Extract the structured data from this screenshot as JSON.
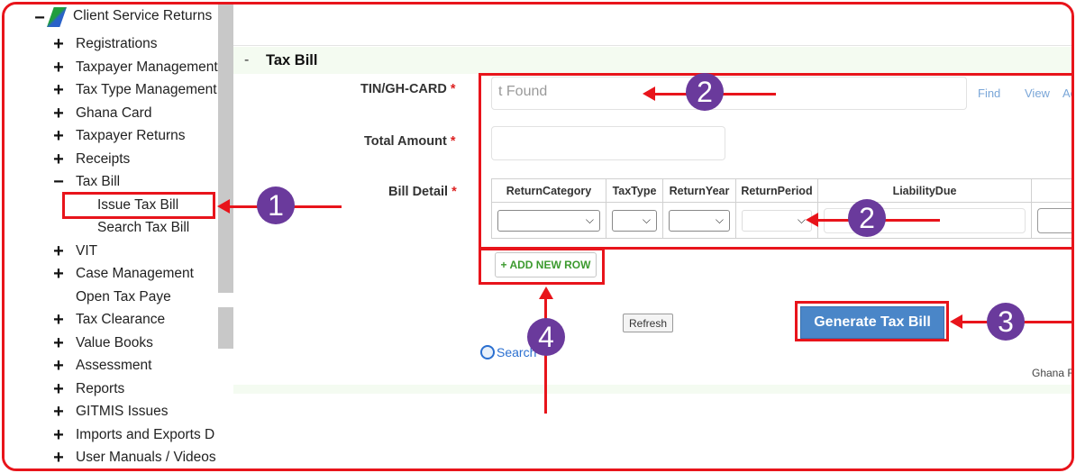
{
  "sidebar": {
    "root_label": "Client Service Returns",
    "items": [
      {
        "sign": "+",
        "label": "Registrations"
      },
      {
        "sign": "+",
        "label": "Taxpayer Management"
      },
      {
        "sign": "+",
        "label": "Tax Type Management"
      },
      {
        "sign": "+",
        "label": "Ghana Card"
      },
      {
        "sign": "+",
        "label": "Taxpayer Returns"
      },
      {
        "sign": "+",
        "label": "Receipts"
      },
      {
        "sign": "−",
        "label": "Tax Bill"
      },
      {
        "sign": "",
        "label": "Issue Tax Bill"
      },
      {
        "sign": "",
        "label": "Search Tax Bill"
      },
      {
        "sign": "+",
        "label": "VIT"
      },
      {
        "sign": "+",
        "label": "Case Management"
      },
      {
        "sign": "",
        "label": "Open Tax Paye"
      },
      {
        "sign": "+",
        "label": "Tax Clearance"
      },
      {
        "sign": "+",
        "label": "Value Books"
      },
      {
        "sign": "+",
        "label": "Assessment"
      },
      {
        "sign": "+",
        "label": "Reports"
      },
      {
        "sign": "+",
        "label": "GITMIS Issues"
      },
      {
        "sign": "+",
        "label": "Imports and Exports D"
      },
      {
        "sign": "+",
        "label": "User Manuals / Videos"
      }
    ]
  },
  "section": {
    "dash": "-",
    "title": "Tax Bill"
  },
  "form": {
    "tin_label": "TIN/GH-CARD",
    "tin_ghost_text": "t Found",
    "total_amount_label": "Total Amount",
    "bill_detail_label": "Bill Detail",
    "required_mark": "*",
    "find_link": "Find",
    "view_link": "View",
    "add_link": "Ac"
  },
  "table": {
    "columns": [
      "ReturnCategory",
      "TaxType",
      "ReturnYear",
      "ReturnPeriod",
      "LiabilityDue",
      ""
    ]
  },
  "buttons": {
    "add_row": "+ ADD NEW ROW",
    "refresh": "Refresh",
    "generate": "Generate Tax Bill",
    "search": "Search"
  },
  "footer": {
    "text": "Ghana R"
  },
  "annotations": {
    "badges": [
      "1",
      "2",
      "2",
      "3",
      "4"
    ],
    "color": "#e8141b",
    "badge_color": "#6a3a9c"
  },
  "colors": {
    "accent_blue": "#4a86c8",
    "add_green": "#3c9a2e",
    "required_red": "#d22222"
  }
}
